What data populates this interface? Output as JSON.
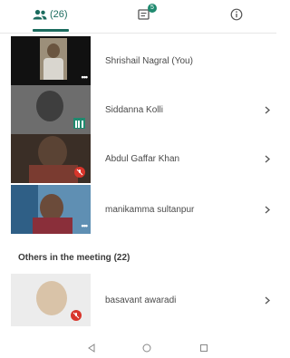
{
  "tabs": {
    "people_label": "(26)",
    "chat_badge": "5",
    "active_color": "#1b6b5e"
  },
  "participants_in_call": [
    {
      "name": "Shrishail Nagral (You)",
      "state": "more",
      "icon": "more-dots-icon"
    },
    {
      "name": "Siddanna Kolli",
      "state": "speaking",
      "icon": "speaking-icon"
    },
    {
      "name": "Abdul Gaffar Khan",
      "state": "muted",
      "icon": "mic-off-icon"
    },
    {
      "name": "manikamma sultanpur",
      "state": "more",
      "icon": "more-dots-icon"
    }
  ],
  "others_section": {
    "title": "Others in the meeting (22)",
    "items": [
      {
        "name": "basavant awaradi",
        "state": "muted",
        "icon": "mic-off-icon"
      }
    ]
  },
  "nav": {
    "back": "back-triangle-icon",
    "home": "home-circle-icon",
    "recents": "recents-square-icon"
  },
  "colors": {
    "accent": "#1b6b5e",
    "muted_red": "#d8352b",
    "speaking_green": "#1f8a6f"
  }
}
